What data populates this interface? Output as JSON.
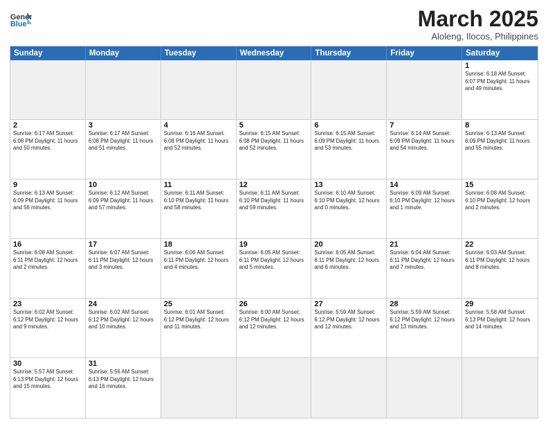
{
  "header": {
    "logo_general": "General",
    "logo_blue": "Blue",
    "month_title": "March 2025",
    "subtitle": "Aloleng, Ilocos, Philippines"
  },
  "days_of_week": [
    "Sunday",
    "Monday",
    "Tuesday",
    "Wednesday",
    "Thursday",
    "Friday",
    "Saturday"
  ],
  "weeks": [
    [
      {
        "day": "",
        "info": "",
        "empty": true
      },
      {
        "day": "",
        "info": "",
        "empty": true
      },
      {
        "day": "",
        "info": "",
        "empty": true
      },
      {
        "day": "",
        "info": "",
        "empty": true
      },
      {
        "day": "",
        "info": "",
        "empty": true
      },
      {
        "day": "",
        "info": "",
        "empty": true
      },
      {
        "day": "1",
        "info": "Sunrise: 6:18 AM\nSunset: 6:07 PM\nDaylight: 11 hours\nand 49 minutes.",
        "empty": false
      }
    ],
    [
      {
        "day": "2",
        "info": "Sunrise: 6:17 AM\nSunset: 6:08 PM\nDaylight: 11 hours\nand 50 minutes.",
        "empty": false
      },
      {
        "day": "3",
        "info": "Sunrise: 6:17 AM\nSunset: 6:08 PM\nDaylight: 11 hours\nand 51 minutes.",
        "empty": false
      },
      {
        "day": "4",
        "info": "Sunrise: 6:16 AM\nSunset: 6:08 PM\nDaylight: 11 hours\nand 52 minutes.",
        "empty": false
      },
      {
        "day": "5",
        "info": "Sunrise: 6:15 AM\nSunset: 6:08 PM\nDaylight: 11 hours\nand 52 minutes.",
        "empty": false
      },
      {
        "day": "6",
        "info": "Sunrise: 6:15 AM\nSunset: 6:09 PM\nDaylight: 11 hours\nand 53 minutes.",
        "empty": false
      },
      {
        "day": "7",
        "info": "Sunrise: 6:14 AM\nSunset: 6:09 PM\nDaylight: 11 hours\nand 54 minutes.",
        "empty": false
      },
      {
        "day": "8",
        "info": "Sunrise: 6:13 AM\nSunset: 6:09 PM\nDaylight: 11 hours\nand 55 minutes.",
        "empty": false
      }
    ],
    [
      {
        "day": "9",
        "info": "Sunrise: 6:13 AM\nSunset: 6:09 PM\nDaylight: 11 hours\nand 56 minutes.",
        "empty": false
      },
      {
        "day": "10",
        "info": "Sunrise: 6:12 AM\nSunset: 6:09 PM\nDaylight: 11 hours\nand 57 minutes.",
        "empty": false
      },
      {
        "day": "11",
        "info": "Sunrise: 6:11 AM\nSunset: 6:10 PM\nDaylight: 11 hours\nand 58 minutes.",
        "empty": false
      },
      {
        "day": "12",
        "info": "Sunrise: 6:11 AM\nSunset: 6:10 PM\nDaylight: 11 hours\nand 59 minutes.",
        "empty": false
      },
      {
        "day": "13",
        "info": "Sunrise: 6:10 AM\nSunset: 6:10 PM\nDaylight: 12 hours\nand 0 minutes.",
        "empty": false
      },
      {
        "day": "14",
        "info": "Sunrise: 6:09 AM\nSunset: 6:10 PM\nDaylight: 12 hours\nand 1 minute.",
        "empty": false
      },
      {
        "day": "15",
        "info": "Sunrise: 6:08 AM\nSunset: 6:10 PM\nDaylight: 12 hours\nand 2 minutes.",
        "empty": false
      }
    ],
    [
      {
        "day": "16",
        "info": "Sunrise: 6:08 AM\nSunset: 6:11 PM\nDaylight: 12 hours\nand 2 minutes.",
        "empty": false
      },
      {
        "day": "17",
        "info": "Sunrise: 6:07 AM\nSunset: 6:11 PM\nDaylight: 12 hours\nand 3 minutes.",
        "empty": false
      },
      {
        "day": "18",
        "info": "Sunrise: 6:06 AM\nSunset: 6:11 PM\nDaylight: 12 hours\nand 4 minutes.",
        "empty": false
      },
      {
        "day": "19",
        "info": "Sunrise: 6:05 AM\nSunset: 6:11 PM\nDaylight: 12 hours\nand 5 minutes.",
        "empty": false
      },
      {
        "day": "20",
        "info": "Sunrise: 6:05 AM\nSunset: 6:11 PM\nDaylight: 12 hours\nand 6 minutes.",
        "empty": false
      },
      {
        "day": "21",
        "info": "Sunrise: 6:04 AM\nSunset: 6:11 PM\nDaylight: 12 hours\nand 7 minutes.",
        "empty": false
      },
      {
        "day": "22",
        "info": "Sunrise: 6:03 AM\nSunset: 6:11 PM\nDaylight: 12 hours\nand 8 minutes.",
        "empty": false
      }
    ],
    [
      {
        "day": "23",
        "info": "Sunrise: 6:02 AM\nSunset: 6:12 PM\nDaylight: 12 hours\nand 9 minutes.",
        "empty": false
      },
      {
        "day": "24",
        "info": "Sunrise: 6:02 AM\nSunset: 6:12 PM\nDaylight: 12 hours\nand 10 minutes.",
        "empty": false
      },
      {
        "day": "25",
        "info": "Sunrise: 6:01 AM\nSunset: 6:12 PM\nDaylight: 12 hours\nand 11 minutes.",
        "empty": false
      },
      {
        "day": "26",
        "info": "Sunrise: 6:00 AM\nSunset: 6:12 PM\nDaylight: 12 hours\nand 12 minutes.",
        "empty": false
      },
      {
        "day": "27",
        "info": "Sunrise: 5:59 AM\nSunset: 6:12 PM\nDaylight: 12 hours\nand 12 minutes.",
        "empty": false
      },
      {
        "day": "28",
        "info": "Sunrise: 5:59 AM\nSunset: 6:12 PM\nDaylight: 12 hours\nand 13 minutes.",
        "empty": false
      },
      {
        "day": "29",
        "info": "Sunrise: 5:58 AM\nSunset: 6:13 PM\nDaylight: 12 hours\nand 14 minutes.",
        "empty": false
      }
    ],
    [
      {
        "day": "30",
        "info": "Sunrise: 5:57 AM\nSunset: 6:13 PM\nDaylight: 12 hours\nand 15 minutes.",
        "empty": false
      },
      {
        "day": "31",
        "info": "Sunrise: 5:56 AM\nSunset: 6:13 PM\nDaylight: 12 hours\nand 16 minutes.",
        "empty": false
      },
      {
        "day": "",
        "info": "",
        "empty": true
      },
      {
        "day": "",
        "info": "",
        "empty": true
      },
      {
        "day": "",
        "info": "",
        "empty": true
      },
      {
        "day": "",
        "info": "",
        "empty": true
      },
      {
        "day": "",
        "info": "",
        "empty": true
      }
    ]
  ]
}
